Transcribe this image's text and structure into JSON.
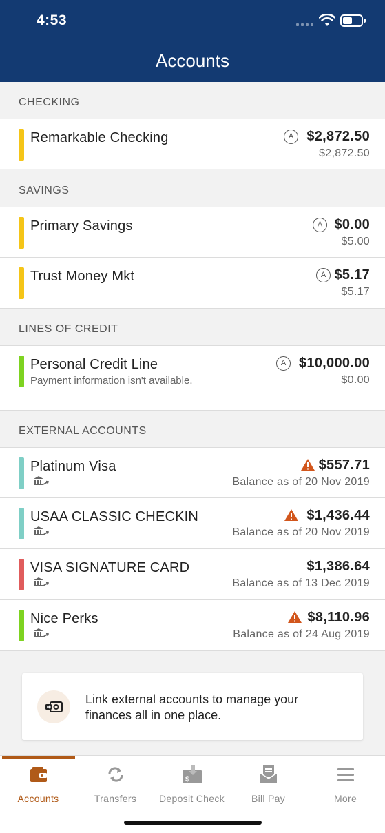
{
  "status": {
    "time": "4:53"
  },
  "header": {
    "title": "Accounts"
  },
  "sections": {
    "checking": "CHECKING",
    "savings": "SAVINGS",
    "lines_of_credit": "LINES OF CREDIT",
    "external": "EXTERNAL ACCOUNTS"
  },
  "accounts": {
    "remarkable_checking": {
      "name": "Remarkable Checking",
      "available": "$2,872.50",
      "current": "$2,872.50",
      "badge": "A",
      "color": "#f5c518"
    },
    "primary_savings": {
      "name": "Primary Savings",
      "available": "$0.00",
      "current": "$5.00",
      "badge": "A",
      "color": "#f5c518"
    },
    "trust_money_mkt": {
      "name": "Trust Money Mkt",
      "available": "$5.17",
      "current": "$5.17",
      "badge": "A",
      "color": "#f5c518"
    },
    "personal_credit_line": {
      "name": "Personal Credit Line",
      "subtitle": "Payment information isn't available.",
      "available": "$10,000.00",
      "current": "$0.00",
      "badge": "A",
      "color": "#7ed321"
    }
  },
  "external_accounts": {
    "platinum_visa": {
      "name": "Platinum Visa",
      "amount": "$557.71",
      "balance_note": "Balance as of 20 Nov 2019",
      "warning": true,
      "color": "#7fcfc6"
    },
    "usaa_classic": {
      "name": "USAA CLASSIC CHECKIN",
      "amount": "$1,436.44",
      "balance_note": "Balance as of 20 Nov 2019",
      "warning": true,
      "color": "#7fcfc6"
    },
    "visa_signature": {
      "name": "VISA SIGNATURE CARD",
      "amount": "$1,386.64",
      "balance_note": "Balance as of 13 Dec 2019",
      "warning": false,
      "color": "#e05c5c"
    },
    "nice_perks": {
      "name": "Nice Perks",
      "amount": "$8,110.96",
      "balance_note": "Balance as of 24 Aug 2019",
      "warning": true,
      "color": "#7ed321"
    }
  },
  "promo": {
    "text": "Link external accounts to manage your finances all in one place."
  },
  "tabs": {
    "accounts": "Accounts",
    "transfers": "Transfers",
    "deposit_check": "Deposit Check",
    "bill_pay": "Bill Pay",
    "more": "More"
  },
  "colors": {
    "header_bg": "#133a72",
    "accent": "#b05a18",
    "warning": "#d2561c"
  }
}
